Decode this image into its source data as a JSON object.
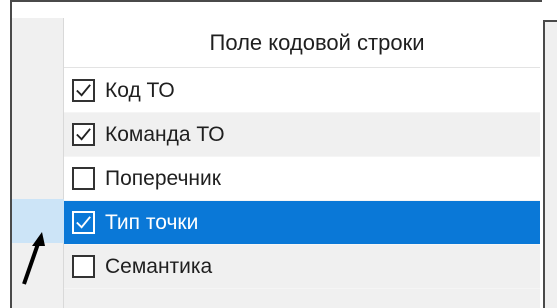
{
  "grid": {
    "header": "Поле кодовой строки",
    "rows": [
      {
        "label": "Код ТО",
        "checked": true
      },
      {
        "label": "Команда ТО",
        "checked": true
      },
      {
        "label": "Поперечник",
        "checked": false
      },
      {
        "label": "Тип точки",
        "checked": true,
        "selected": true
      },
      {
        "label": "Семантика",
        "checked": false
      }
    ]
  },
  "colors": {
    "selection": "#0a78d7",
    "alt_row": "#f0f0f0",
    "gutter_selection": "#cce4f7"
  },
  "icons": {
    "check": "checkmark-icon",
    "cursor": "mouse-pointer-icon"
  }
}
